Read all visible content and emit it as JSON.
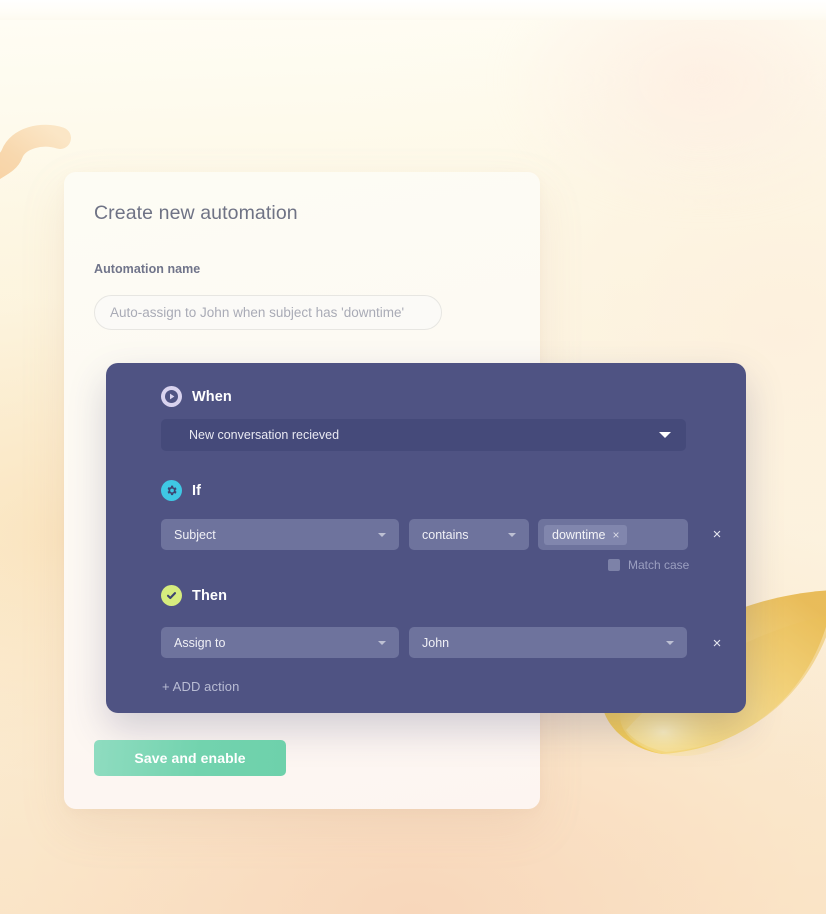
{
  "card": {
    "title": "Create new automation",
    "name_label": "Automation name",
    "name_placeholder": "Auto-assign to John when subject has 'downtime'",
    "name_value": ""
  },
  "panel": {
    "when": {
      "label": "When",
      "icon": "play-circle-icon",
      "badge_color": "#d9d3ef",
      "trigger_value": "New conversation recieved"
    },
    "if": {
      "label": "If",
      "icon": "gear-circle-icon",
      "badge_color": "#3fc8e4",
      "field_value": "Subject",
      "operator_value": "contains",
      "tags": [
        "downtime"
      ],
      "tag_remove_label": "×",
      "remove_label": "×",
      "match_case_label": "Match case",
      "match_case_checked": false
    },
    "then": {
      "label": "Then",
      "icon": "check-circle-icon",
      "badge_color": "#d6ec7e",
      "action_value": "Assign to",
      "target_value": "John",
      "remove_label": "×"
    },
    "add_action_label": "+ ADD action"
  },
  "footer": {
    "save_label": "Save and enable",
    "save_color": "#72d3ae"
  },
  "decor": {
    "squiggle_color": "#f6d0a6",
    "petal_color": "#f3c653",
    "panel_color": "#4f5383"
  }
}
